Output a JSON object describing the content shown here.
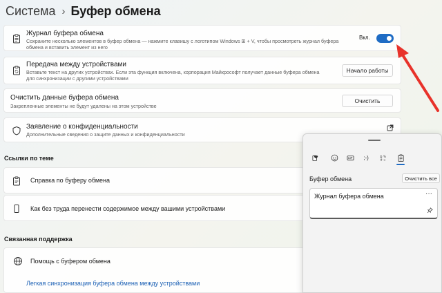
{
  "breadcrumb": {
    "root": "Система",
    "separator": "›",
    "current": "Буфер обмена"
  },
  "settings": {
    "history": {
      "title": "Журнал буфера обмена",
      "description": "Сохраните несколько элементов в буфер обмена — нажмите клавишу с логотипом Windows ⊞ + V, чтобы просмотреть журнал буфера обмена и вставить элемент из него",
      "toggle_label": "Вкл.",
      "toggle_on": true
    },
    "sync": {
      "title": "Передача между устройствами",
      "description": "Вставьте текст на других устройствах. Если эта функция включена, корпорация Майкрософт получает данные буфера обмена для синхронизации с другими устройствами",
      "button": "Начало работы"
    },
    "clear": {
      "title": "Очистить данные буфера обмена",
      "description": "Закрепленные элементы не будут удалены на этом устройстве",
      "button": "Очистить"
    },
    "privacy": {
      "title": "Заявление о конфиденциальности",
      "description": "Дополнительные сведения о защите данных и конфиденциальности"
    }
  },
  "related_links": {
    "heading": "Ссылки по теме",
    "items": [
      {
        "label": "Справка по буферу обмена"
      },
      {
        "label": "Как без труда перенести содержимое между вашими устройствами"
      }
    ]
  },
  "related_support": {
    "heading": "Связанная поддержка",
    "item": "Помощь с буфером обмена",
    "link": "Легкая синхронизация буфера обмена между устройствами"
  },
  "flyout": {
    "title": "Буфер обмена",
    "clear_all": "Очистить все",
    "tabs": [
      "heart-emoji-icon",
      "smiley-icon",
      "gif-icon",
      "kaomoji-icon",
      "symbols-icon",
      "clipboard-icon"
    ],
    "items": [
      {
        "text": "Журнал буфера обмена",
        "more": "···"
      }
    ]
  },
  "colors": {
    "accent": "#1f6cc4",
    "arrow": "#e8322a",
    "link": "#1a5fb4"
  }
}
